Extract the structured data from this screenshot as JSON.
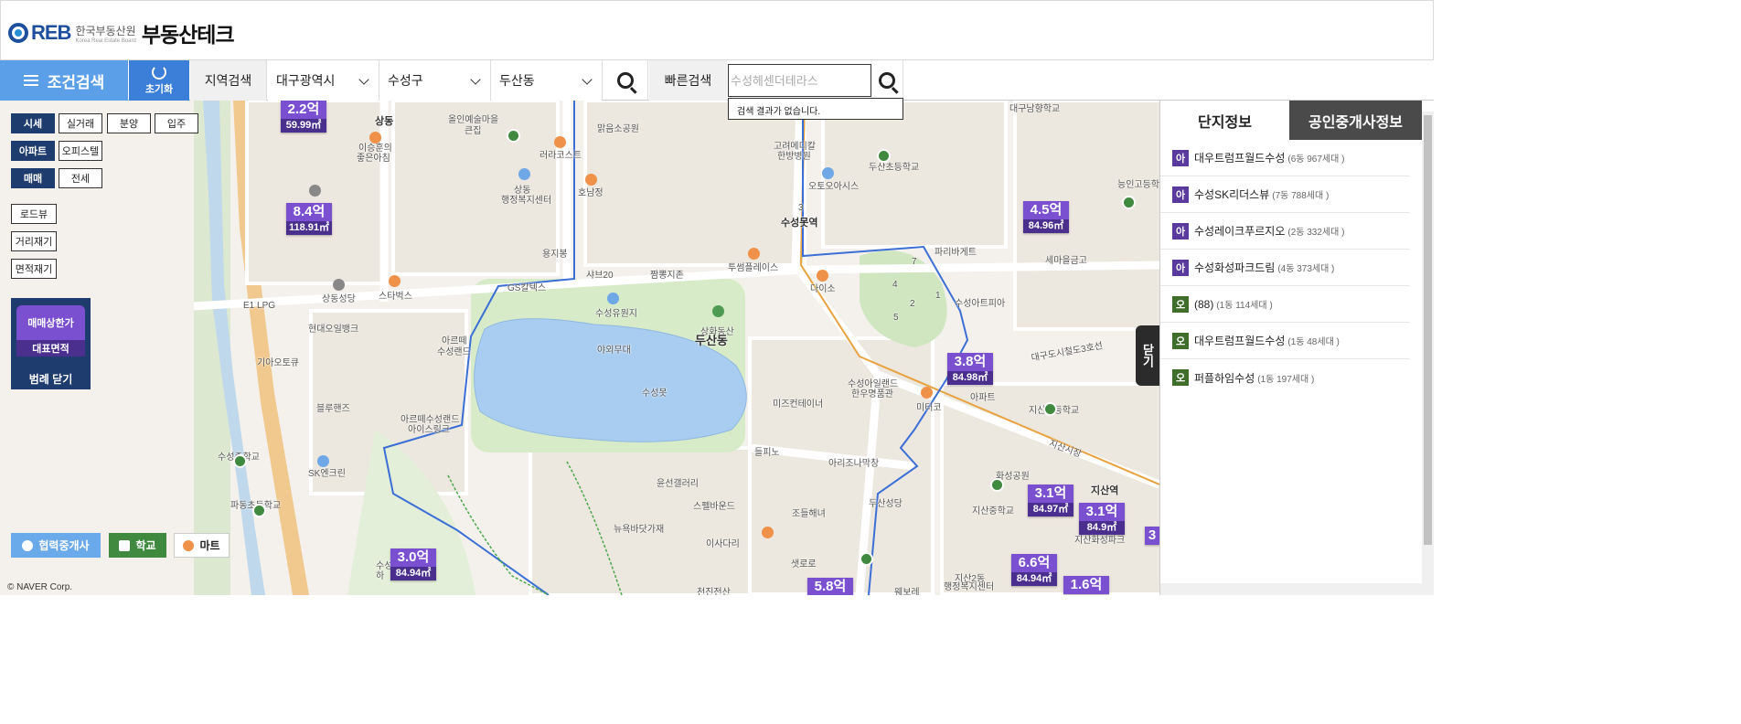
{
  "header": {
    "logo_text": "REB",
    "logo_korean": "한국부동산원",
    "logo_english": "Korea Real Estate Board",
    "site_title": "부동산테크"
  },
  "searchbar": {
    "condition_search": "조건검색",
    "reset": "초기화",
    "region_search": "지역검색",
    "city": "대구광역시",
    "district": "수성구",
    "dong": "두산동",
    "quick_search": "빠른검색",
    "quick_search_placeholder": "수성헤센더테라스",
    "no_result": "검색 결과가 없습니다."
  },
  "filters": {
    "price_type": [
      "시세",
      "실거래",
      "분양",
      "입주"
    ],
    "building_type": [
      "아파트",
      "오피스텔"
    ],
    "deal_type": [
      "매매",
      "전세"
    ],
    "tools": [
      "로드뷰",
      "거리재기",
      "면적재기"
    ]
  },
  "legend": {
    "top": "매매상한가",
    "bottom": "대표면적",
    "close": "범례 닫기"
  },
  "bottom_buttons": {
    "broker": "협력중개사",
    "school": "학교",
    "mart": "마트"
  },
  "copyright": "© NAVER Corp.",
  "map_labels": [
    "상동",
    "올인예술마을",
    "큰집",
    "맑음소공원",
    "고려메디칼",
    "한방병원",
    "두산초등학교",
    "대구남향학교",
    "능인고등학교",
    "이승훈의",
    "좋은아침",
    "러라코스트",
    "상동",
    "행정복지센터",
    "호남정",
    "오토오아시스",
    "수성못역",
    "파리바게트",
    "세마을금고",
    "용지봉",
    "샤브20",
    "짬뽕지존",
    "투썸플레이스",
    "다이소",
    "스타벅스",
    "GS칼텍스",
    "상동성당",
    "E1 LPG",
    "현대오일뱅크",
    "수성유원지",
    "수성못",
    "상화동산",
    "두산동",
    "수성아트피아",
    "아르떼",
    "수성랜드",
    "야외무대",
    "기아오토큐",
    "수성아일랜드",
    "한우명품관",
    "미즈컨테이너",
    "미터코",
    "아파트",
    "블루핸즈",
    "아르떼수성랜드",
    "아이스링크",
    "지산초등학교",
    "들피노",
    "아리조나막창",
    "화성공원",
    "수성중학교",
    "SK엔크린",
    "윤선갤러리",
    "두산성당",
    "지산중학교",
    "지산역",
    "파동초등학교",
    "스펠바운드",
    "조들해녀",
    "뉴욕바닷가재",
    "이사다리",
    "샛로로",
    "수성",
    "하",
    "천진전산",
    "웨보레",
    "지산2동",
    "행정복지센터",
    "지산화성파크",
    "1",
    "2",
    "3",
    "4",
    "5",
    "7",
    "대구도시철도3호선",
    "지산시장"
  ],
  "price_markers": [
    {
      "price": "2.2억",
      "area": "59.99㎡"
    },
    {
      "price": "8.4억",
      "area": "118.91㎡"
    },
    {
      "price": "4.5억",
      "area": "84.96㎡"
    },
    {
      "price": "3.8억",
      "area": "84.98㎡"
    },
    {
      "price": "3.1억",
      "area": "84.97㎡"
    },
    {
      "price": "3.1억",
      "area": "84.9㎡"
    },
    {
      "price": "3.0억",
      "area": "84.94㎡"
    },
    {
      "price": "6.6억",
      "area": "84.94㎡"
    },
    {
      "price": "5.8억",
      "area": ""
    },
    {
      "price": "1.6억",
      "area": ""
    },
    {
      "price": "3",
      "area": ""
    }
  ],
  "panel": {
    "tabs": [
      "단지정보",
      "공인중개사정보"
    ],
    "close": "닫기",
    "complexes": [
      {
        "type": "아",
        "name": "대우트럼프월드수성",
        "info": "(6동 967세대 )"
      },
      {
        "type": "아",
        "name": "수성SK리더스뷰",
        "info": "(7동 788세대 )"
      },
      {
        "type": "아",
        "name": "수성레이크푸르지오",
        "info": "(2동 332세대 )"
      },
      {
        "type": "아",
        "name": "수성화성파크드림",
        "info": "(4동 373세대 )"
      },
      {
        "type": "오",
        "name": "(88)",
        "info": "(1동 114세대 )"
      },
      {
        "type": "오",
        "name": "대우트럼프월드수성",
        "info": "(1동 48세대 )"
      },
      {
        "type": "오",
        "name": "퍼플하임수성",
        "info": "(1동 197세대 )"
      }
    ]
  },
  "colors": {
    "primary_blue": "#5a9fe8",
    "dark_blue": "#1f3c6e",
    "marker_purple": "#7a4fd0",
    "apt_type": "#5b3a9e",
    "officetel_type": "#3f6e2a"
  }
}
